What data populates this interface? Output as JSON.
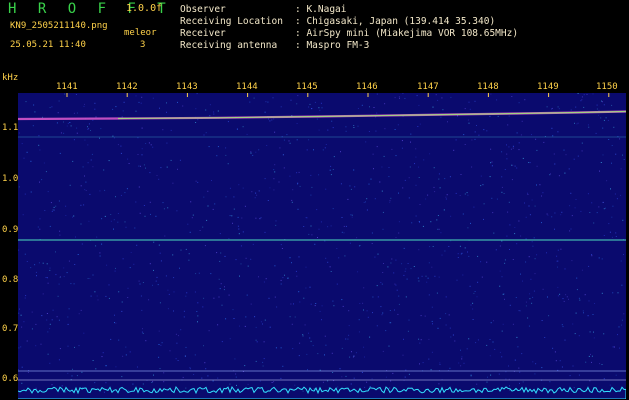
{
  "app": {
    "title": "H R O F F T",
    "version": "1.0.0f"
  },
  "file": {
    "name": "KN9_2505211140.png",
    "datetime": "25.05.21 11:40"
  },
  "mode": {
    "label": "meleor",
    "value": "3"
  },
  "info": [
    {
      "label": "Observer",
      "value": ": K.Nagai"
    },
    {
      "label": "Receiving Location",
      "value": ": Chigasaki, Japan (139.414 35.340)"
    },
    {
      "label": "Receiver",
      "value": ": AirSpy mini (Miakejima VOR 108.65MHz)"
    },
    {
      "label": "Receiving antenna",
      "value": ": Maspro FM-3"
    }
  ],
  "axis": {
    "unit": "kHz",
    "y_ticks": [
      "1.1",
      "1.0",
      "0.9",
      "0.8",
      "0.7",
      "0.6"
    ],
    "x_ticks": [
      "1141",
      "1142",
      "1143",
      "1144",
      "1145",
      "1146",
      "1147",
      "1148",
      "1149",
      "1150"
    ]
  },
  "colors": {
    "background": "#000000",
    "plot_background": "#0a0a6e",
    "label_yellow": "#ffd24a",
    "title_green": "#39d24a",
    "info_text": "#f2e7c8",
    "carrier_line": "#46c8b4",
    "noise_floor": "#33e0ff"
  }
}
